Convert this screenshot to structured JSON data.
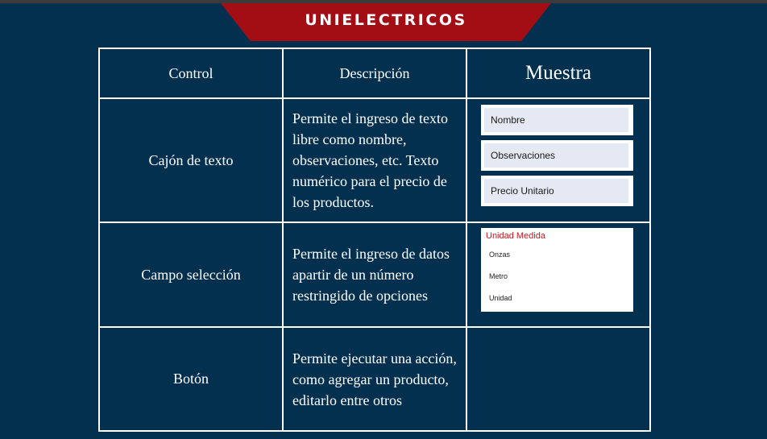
{
  "banner": {
    "title": "UNIELECTRICOS"
  },
  "table": {
    "headers": [
      "Control",
      "Descripción",
      "Muestra"
    ],
    "rows": [
      {
        "control": "Cajón de texto",
        "description": "Permite el ingreso de texto libre como nombre, observaciones, etc. Texto numérico para el precio de los productos.",
        "sample": {
          "fields": [
            "Nombre",
            "Observaciones",
            "Precio Unitario"
          ]
        }
      },
      {
        "control": "Campo selección",
        "description": "Permite el ingreso de datos apartir de un número restringido de opciones",
        "sample": {
          "label": "Unidad Medida",
          "options": [
            "Onzas",
            "Metro",
            "Unidad"
          ]
        }
      },
      {
        "control": "Botón",
        "description": "Permite ejecutar una acción, como agregar un producto, editarlo entre otros"
      }
    ]
  },
  "colors": {
    "background": "#04304f",
    "banner": "#a30e14",
    "border": "#ffffff",
    "field_fill": "#e5e9f4",
    "select_label": "#c0191f"
  }
}
